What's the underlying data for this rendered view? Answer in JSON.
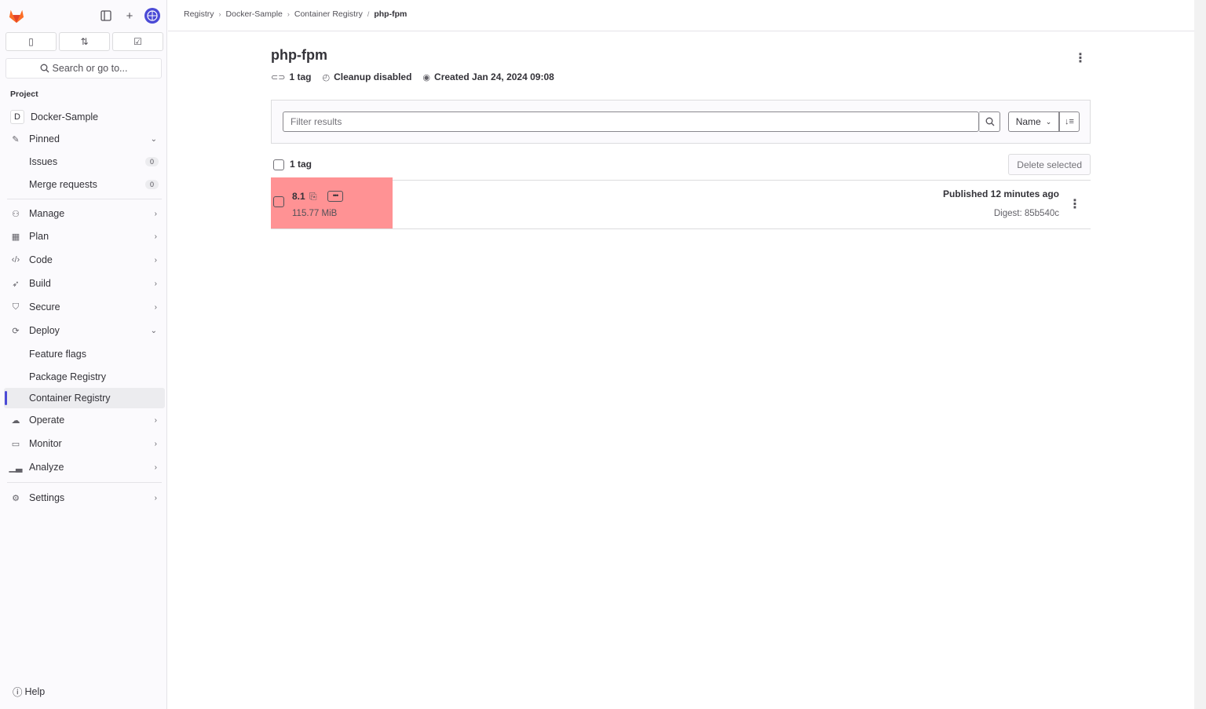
{
  "sidebar": {
    "search_placeholder": "Search or go to...",
    "project_label": "Project",
    "project": {
      "avatar_letter": "D",
      "name": "Docker-Sample"
    },
    "pinned": {
      "label": "Pinned",
      "items": [
        {
          "label": "Issues",
          "count": "0"
        },
        {
          "label": "Merge requests",
          "count": "0"
        }
      ]
    },
    "sections": [
      {
        "label": "Manage"
      },
      {
        "label": "Plan"
      },
      {
        "label": "Code"
      },
      {
        "label": "Build"
      },
      {
        "label": "Secure"
      }
    ],
    "deploy": {
      "label": "Deploy",
      "items": [
        {
          "label": "Feature flags"
        },
        {
          "label": "Package Registry"
        },
        {
          "label": "Container Registry"
        }
      ]
    },
    "sections_after": [
      {
        "label": "Operate"
      },
      {
        "label": "Monitor"
      },
      {
        "label": "Analyze"
      }
    ],
    "settings": "Settings",
    "help": "Help"
  },
  "breadcrumbs": [
    "Registry",
    "Docker-Sample",
    "Container Registry",
    "php-fpm"
  ],
  "page": {
    "title": "php-fpm",
    "meta": {
      "tags": "1 tag",
      "cleanup": "Cleanup disabled",
      "created": "Created Jan 24, 2024 09:08"
    }
  },
  "filter": {
    "placeholder": "Filter results",
    "sort_label": "Name"
  },
  "list": {
    "header": "1 tag",
    "delete_label": "Delete selected",
    "rows": [
      {
        "tag": "8.1",
        "size": "115.77 MiB",
        "published": "Published 12 minutes ago",
        "digest": "Digest: 85b540c"
      }
    ]
  },
  "colors": {
    "accent": "#4b4ad6",
    "highlight": "#ff9294",
    "logo": "#e24329"
  }
}
